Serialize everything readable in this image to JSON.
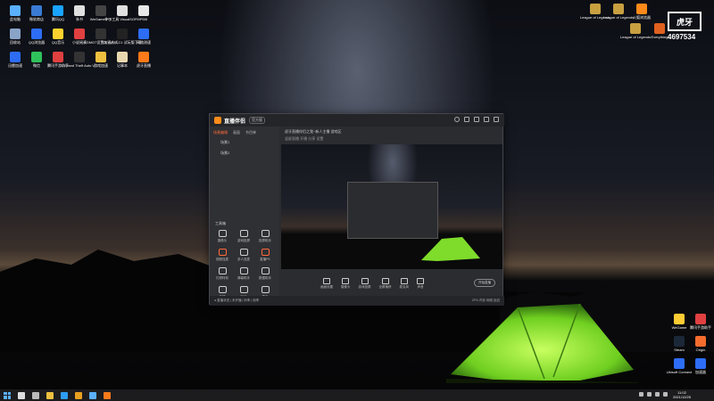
{
  "desktop": {
    "left_icons": [
      {
        "label": "此电脑",
        "color": "#5ab0ff"
      },
      {
        "label": "微软商店",
        "color": "#3a7bd5"
      },
      {
        "label": "腾讯QQ",
        "color": "#1aa3ff"
      },
      {
        "label": "朱书",
        "color": "#e0e0e0"
      },
      {
        "label": "WeGame Pro",
        "color": "#444444"
      },
      {
        "label": "补丁工具 VisualSGFM",
        "color": "#e0e0e0"
      },
      {
        "label": "PDB",
        "color": "#e8e8e8"
      },
      {
        "label": "回收站",
        "color": "#8aa4c8"
      },
      {
        "label": "QQ浏览器",
        "color": "#2d6df6"
      },
      {
        "label": "QQ音乐",
        "color": "#ffd22e"
      },
      {
        "label": "小说阅读",
        "color": "#e04040"
      },
      {
        "label": "RGMG7设置加速方式",
        "color": "#333333"
      },
      {
        "label": "GLYMU.LC1 试玩版下载",
        "color": "#222222"
      },
      {
        "label": "网络测速",
        "color": "#2d6df6"
      },
      {
        "label": "迅雷加速",
        "color": "#2d6df6"
      },
      {
        "label": "微信",
        "color": "#2fc25b"
      },
      {
        "label": "腾讯手游助手",
        "color": "#e04040"
      },
      {
        "label": "Grand Theft Auto V",
        "color": "#333333"
      },
      {
        "label": "游戏加速",
        "color": "#f0c040"
      },
      {
        "label": "记事本",
        "color": "#e8d8b0"
      },
      {
        "label": "虎牙直播",
        "color": "#ff7a1a"
      }
    ],
    "right_icons": [
      {
        "label": "League of Legends",
        "color": "#c8a040"
      },
      {
        "label": "League of Legends",
        "color": "#c8a040"
      },
      {
        "label": "火狐浏览器",
        "color": "#ff8a1a"
      },
      {
        "label": "League of Legends",
        "color": "#c8a040"
      },
      {
        "label": "Everything",
        "color": "#e06020"
      }
    ],
    "bottom_right_icons": [
      {
        "label": "WeGame",
        "color": "#ffcc33"
      },
      {
        "label": "腾讯手游助手",
        "color": "#e04040"
      },
      {
        "label": "Steam",
        "color": "#1b2838"
      },
      {
        "label": "Origin",
        "color": "#f56c2d"
      },
      {
        "label": "Ubisoft Connect",
        "color": "#2d6df6"
      },
      {
        "label": "加速器",
        "color": "#2d6df6"
      }
    ]
  },
  "watermark": {
    "box_text": "虎牙",
    "number": "4697534"
  },
  "app": {
    "name": "直播伴侣",
    "version_badge": "官方版",
    "left_tabs": [
      "场景编辑",
      "画面",
      "节目单"
    ],
    "scenes": [
      "场景1",
      "场景2"
    ],
    "tools_title": "工具箱",
    "tools": [
      "摄像头",
      "游戏投屏",
      "投屏助手",
      "视频连麦",
      "多人连麦",
      "直播PK",
      "礼物特效",
      "弹幕助手",
      "数据助手",
      "美颜",
      "贴纸",
      "更多"
    ],
    "preview_title": "虎牙直播伴侣之我~新人主播 游戏区",
    "preview_subtitle": "竖屏直播  开播  分享  设置",
    "bottom_buttons": [
      "画面设置",
      "摄像头",
      "游戏投屏",
      "全屏捕获",
      "麦克风",
      "声音"
    ],
    "start_button": "开始直播",
    "status_left": "● 直播状态 | 未开播 | 码率 | 帧率",
    "status_right": "CPU  内存  网络  延迟"
  },
  "taskbar": {
    "time": "11:02",
    "date": "2021/12/25",
    "icons": [
      "search-icon",
      "task-view-icon",
      "explorer-icon",
      "edge-icon",
      "chrome-icon",
      "store-icon",
      "live-icon"
    ]
  },
  "colors": {
    "accent": "#ff6a3a",
    "tent": "#7fdc2a"
  }
}
